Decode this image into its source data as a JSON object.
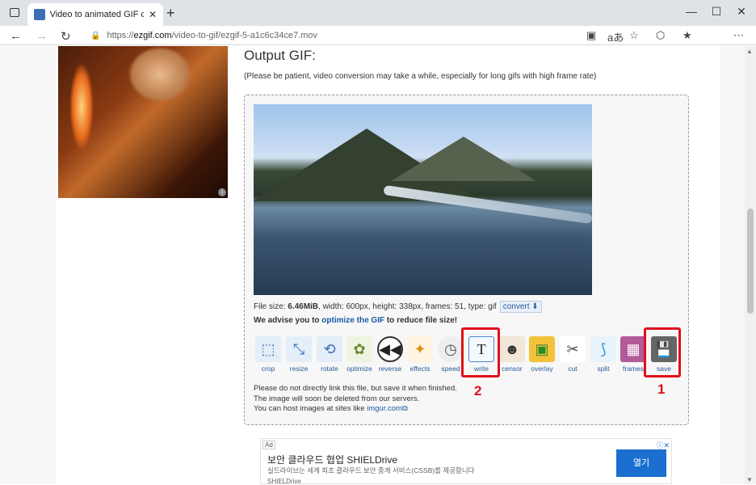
{
  "browser": {
    "tab_title": "Video to animated GIF converter",
    "url_prefix": "https://",
    "url_host": "ezgif.com",
    "url_path": "/video-to-gif/ezgif-5-a1c6c34ce7.mov"
  },
  "page": {
    "heading": "Output GIF:",
    "note": "(Please be patient, video conversion may take a while, especially for long gifs with high frame rate)",
    "file_size_label": "File size: ",
    "file_size": "6.46MiB",
    "file_details": ", width: 600px, height: 338px, frames: 51, type: gif",
    "convert_label": "convert",
    "advise_pre": "We advise you to ",
    "advise_link": "optimize the GIF",
    "advise_post": " to reduce file size!",
    "warn_line1": "Please do not directly link this file, but save it when finished.",
    "warn_line2": "The image will soon be deleted from our servers.",
    "warn_line3_pre": "You can host images at sites like ",
    "warn_line3_link": "imgur.com"
  },
  "tools": [
    {
      "label": "crop",
      "icon": "crop-icon"
    },
    {
      "label": "resize",
      "icon": "resize-icon"
    },
    {
      "label": "rotate",
      "icon": "rotate-icon"
    },
    {
      "label": "optimize",
      "icon": "optimize-icon"
    },
    {
      "label": "reverse",
      "icon": "reverse-icon"
    },
    {
      "label": "effects",
      "icon": "effects-icon"
    },
    {
      "label": "speed",
      "icon": "speed-icon"
    },
    {
      "label": "write",
      "icon": "write-icon"
    },
    {
      "label": "censor",
      "icon": "censor-icon"
    },
    {
      "label": "overlay",
      "icon": "overlay-icon"
    },
    {
      "label": "cut",
      "icon": "scissors-icon"
    },
    {
      "label": "split",
      "icon": "split-icon"
    },
    {
      "label": "frames",
      "icon": "frames-icon"
    },
    {
      "label": "save",
      "icon": "floppy-disk-icon"
    }
  ],
  "annotations": {
    "first": "1",
    "second": "2"
  },
  "ad": {
    "tag": "Ad",
    "title": "보안 클라우드 협업 SHIELDrive",
    "subtitle": "실드라이브는 세계 최초 클라우드 보안 중계 서비스(CSSB)를 제공합니다",
    "footer": "SHIELDrive",
    "button": "열기"
  },
  "colors": {
    "highlight": "#e0101a",
    "link": "#1a5aa6"
  }
}
